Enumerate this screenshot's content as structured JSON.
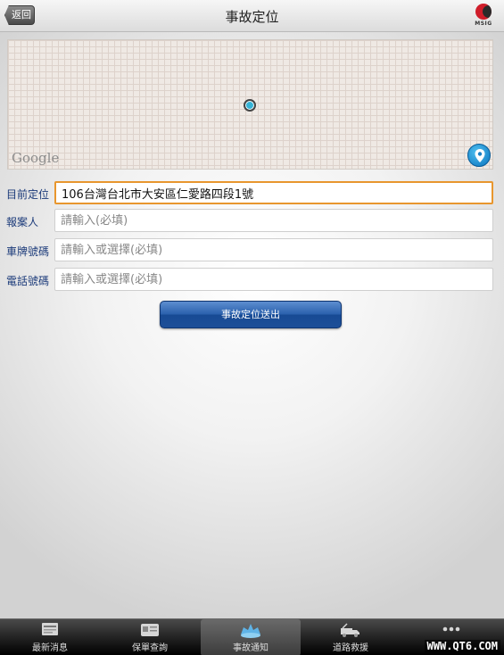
{
  "header": {
    "back_label": "返回",
    "title": "事故定位",
    "logo_text": "MSIG"
  },
  "map": {
    "provider_label": "Google"
  },
  "form": {
    "location": {
      "label": "目前定位",
      "value": "106台灣台北市大安區仁愛路四段1號"
    },
    "reporter": {
      "label": "報案人",
      "placeholder": "請輸入(必填)"
    },
    "plate": {
      "label": "車牌號碼",
      "placeholder": "請輸入或選擇(必填)"
    },
    "phone": {
      "label": "電話號碼",
      "placeholder": "請輸入或選擇(必填)"
    },
    "submit_label": "事故定位送出"
  },
  "tabs": [
    {
      "label": "最新消息",
      "icon": "news-icon"
    },
    {
      "label": "保單查詢",
      "icon": "policy-card-icon"
    },
    {
      "label": "事故通知",
      "icon": "crash-icon",
      "active": true
    },
    {
      "label": "道路救援",
      "icon": "tow-truck-icon"
    },
    {
      "label": "",
      "icon": "more-dots-icon"
    }
  ],
  "watermark": "WWW.QT6.COM",
  "colors": {
    "label_blue": "#1c3b7a",
    "focus_orange": "#e8962e",
    "button_blue": "#2b61ad",
    "marker_cyan": "#35b3d6"
  }
}
